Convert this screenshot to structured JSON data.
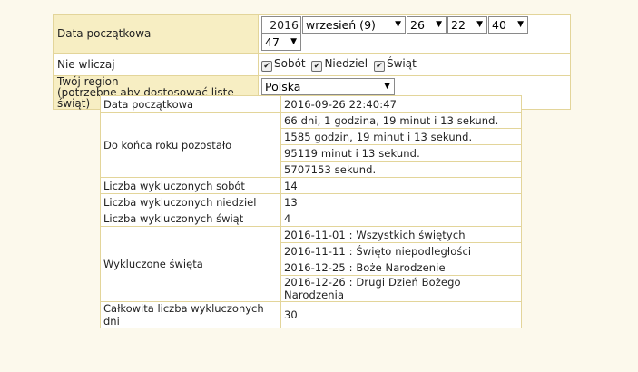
{
  "form": {
    "start_date_label": "Data początkowa",
    "year": "2016",
    "month": "wrzesień (9)",
    "day": "26",
    "hour": "22",
    "minute": "40",
    "second": "47",
    "exclude_label": "Nie wliczaj",
    "exclude_options": [
      {
        "label": "Sobót",
        "checked": true
      },
      {
        "label": "Niedziel",
        "checked": true
      },
      {
        "label": "Świąt",
        "checked": true
      }
    ],
    "region_label_line1": "Twój region",
    "region_label_line2": "(potrzebne aby dostosować listę świąt)",
    "region_value": "Polska"
  },
  "results": {
    "start_date_label": "Data początkowa",
    "start_date_value": "2016-09-26 22:40:47",
    "remaining_label": "Do końca roku pozostało",
    "remaining_values": [
      "66 dni, 1 godzina, 19 minut i 13 sekund.",
      "1585 godzin, 19 minut i 13 sekund.",
      "95119 minut i 13 sekund.",
      "5707153 sekund."
    ],
    "saturdays_label": "Liczba wykluczonych sobót",
    "saturdays_value": "14",
    "sundays_label": "Liczba wykluczonych niedziel",
    "sundays_value": "13",
    "holidays_label": "Liczba wykluczonych świąt",
    "holidays_value": "4",
    "excluded_holidays_label": "Wykluczone święta",
    "excluded_holidays": [
      "2016-11-01 : Wszystkich świętych",
      "2016-11-11 : Święto niepodległości",
      "2016-12-25 : Boże Narodzenie",
      "2016-12-26 : Drugi Dzień Bożego Narodzenia"
    ],
    "total_label": "Całkowita liczba wykluczonych dni",
    "total_value": "30"
  },
  "icons": {
    "dropdown": "chevron-down-icon",
    "checkbox": "checkmark-icon"
  }
}
